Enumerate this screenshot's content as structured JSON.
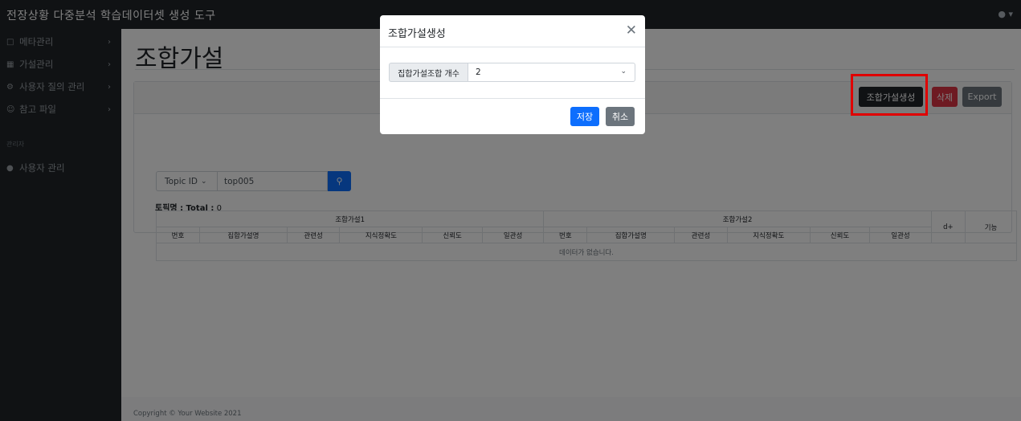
{
  "app": {
    "title": "전장상황 다중분석 학습데이터셋 생성 도구",
    "user_icon": "person-icon"
  },
  "sidebar": {
    "items": [
      {
        "label": "메타관리",
        "icon": "calendar-icon"
      },
      {
        "label": "가설관리",
        "icon": "grid-icon"
      },
      {
        "label": "사용자 질의 관리",
        "icon": "settings-icon"
      },
      {
        "label": "참고 파일",
        "icon": "people-icon"
      }
    ],
    "admin_heading": "관리자",
    "admin_items": [
      {
        "label": "사용자 관리",
        "icon": "person-icon"
      }
    ]
  },
  "main": {
    "page_title": "조합가설",
    "toolbar": {
      "create_label": "조합가설생성",
      "delete_label": "삭제",
      "export_label": "Export"
    },
    "search": {
      "field_label": "Topic ID",
      "value": "top005"
    },
    "total": {
      "label": "토픽명 : Total :",
      "count": "0"
    },
    "table": {
      "group_headers": [
        "조합가설1",
        "조합가설2"
      ],
      "columns": [
        "번호",
        "집합가설명",
        "관련성",
        "지식정확도",
        "신뢰도",
        "일관성",
        "번호",
        "집합가설명",
        "관련성",
        "지식정확도",
        "신뢰도",
        "일관성"
      ],
      "extra_columns": [
        "d+",
        "기능"
      ],
      "empty_message": "데이터가 없습니다."
    },
    "footer": "Copyright © Your Website 2021"
  },
  "modal": {
    "title": "조합가설생성",
    "field_label": "집합가설조합 개수",
    "field_value": "2",
    "save_label": "저장",
    "cancel_label": "취소"
  },
  "colors": {
    "topbar": "#212529",
    "primary": "#0d6efd",
    "danger": "#dc3545",
    "secondary": "#6c757d",
    "highlight": "#e00000"
  }
}
